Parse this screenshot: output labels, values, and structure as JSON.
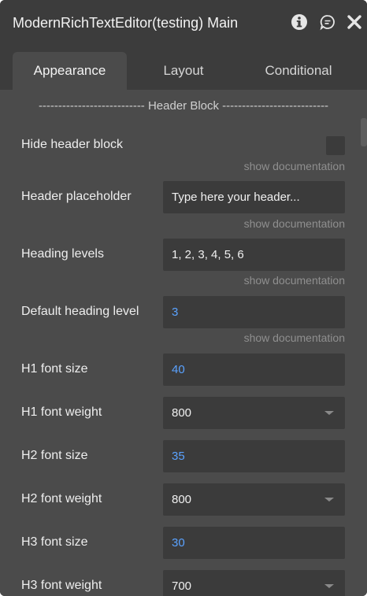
{
  "window": {
    "title": "ModernRichTextEditor(testing) Main"
  },
  "icons": {
    "info": "info-icon",
    "chat": "chat-icon",
    "close": "close-icon"
  },
  "tabs": [
    {
      "label": "Appearance",
      "active": true
    },
    {
      "label": "Layout",
      "active": false
    },
    {
      "label": "Conditional",
      "active": false
    }
  ],
  "section": {
    "divider": "--------------------------- Header Block ---------------------------"
  },
  "doc_link_label": "show documentation",
  "fields": {
    "hide_header": {
      "label": "Hide header block",
      "checked": false
    },
    "header_placeholder": {
      "label": "Header placeholder",
      "value": "Type here your header..."
    },
    "heading_levels": {
      "label": "Heading levels",
      "value": "1, 2, 3, 4, 5, 6"
    },
    "default_heading_level": {
      "label": "Default heading level",
      "value": "3"
    },
    "h1_font_size": {
      "label": "H1 font size",
      "value": "40"
    },
    "h1_font_weight": {
      "label": "H1 font weight",
      "value": "800"
    },
    "h2_font_size": {
      "label": "H2 font size",
      "value": "35"
    },
    "h2_font_weight": {
      "label": "H2 font weight",
      "value": "800"
    },
    "h3_font_size": {
      "label": "H3 font size",
      "value": "30"
    },
    "h3_font_weight": {
      "label": "H3 font weight",
      "value": "700"
    }
  },
  "colors": {
    "panel_bg": "#4b4b4b",
    "header_bg": "#3c3c3c",
    "field_bg": "#3b3b3b",
    "dynamic_value": "#5aa2ff"
  }
}
